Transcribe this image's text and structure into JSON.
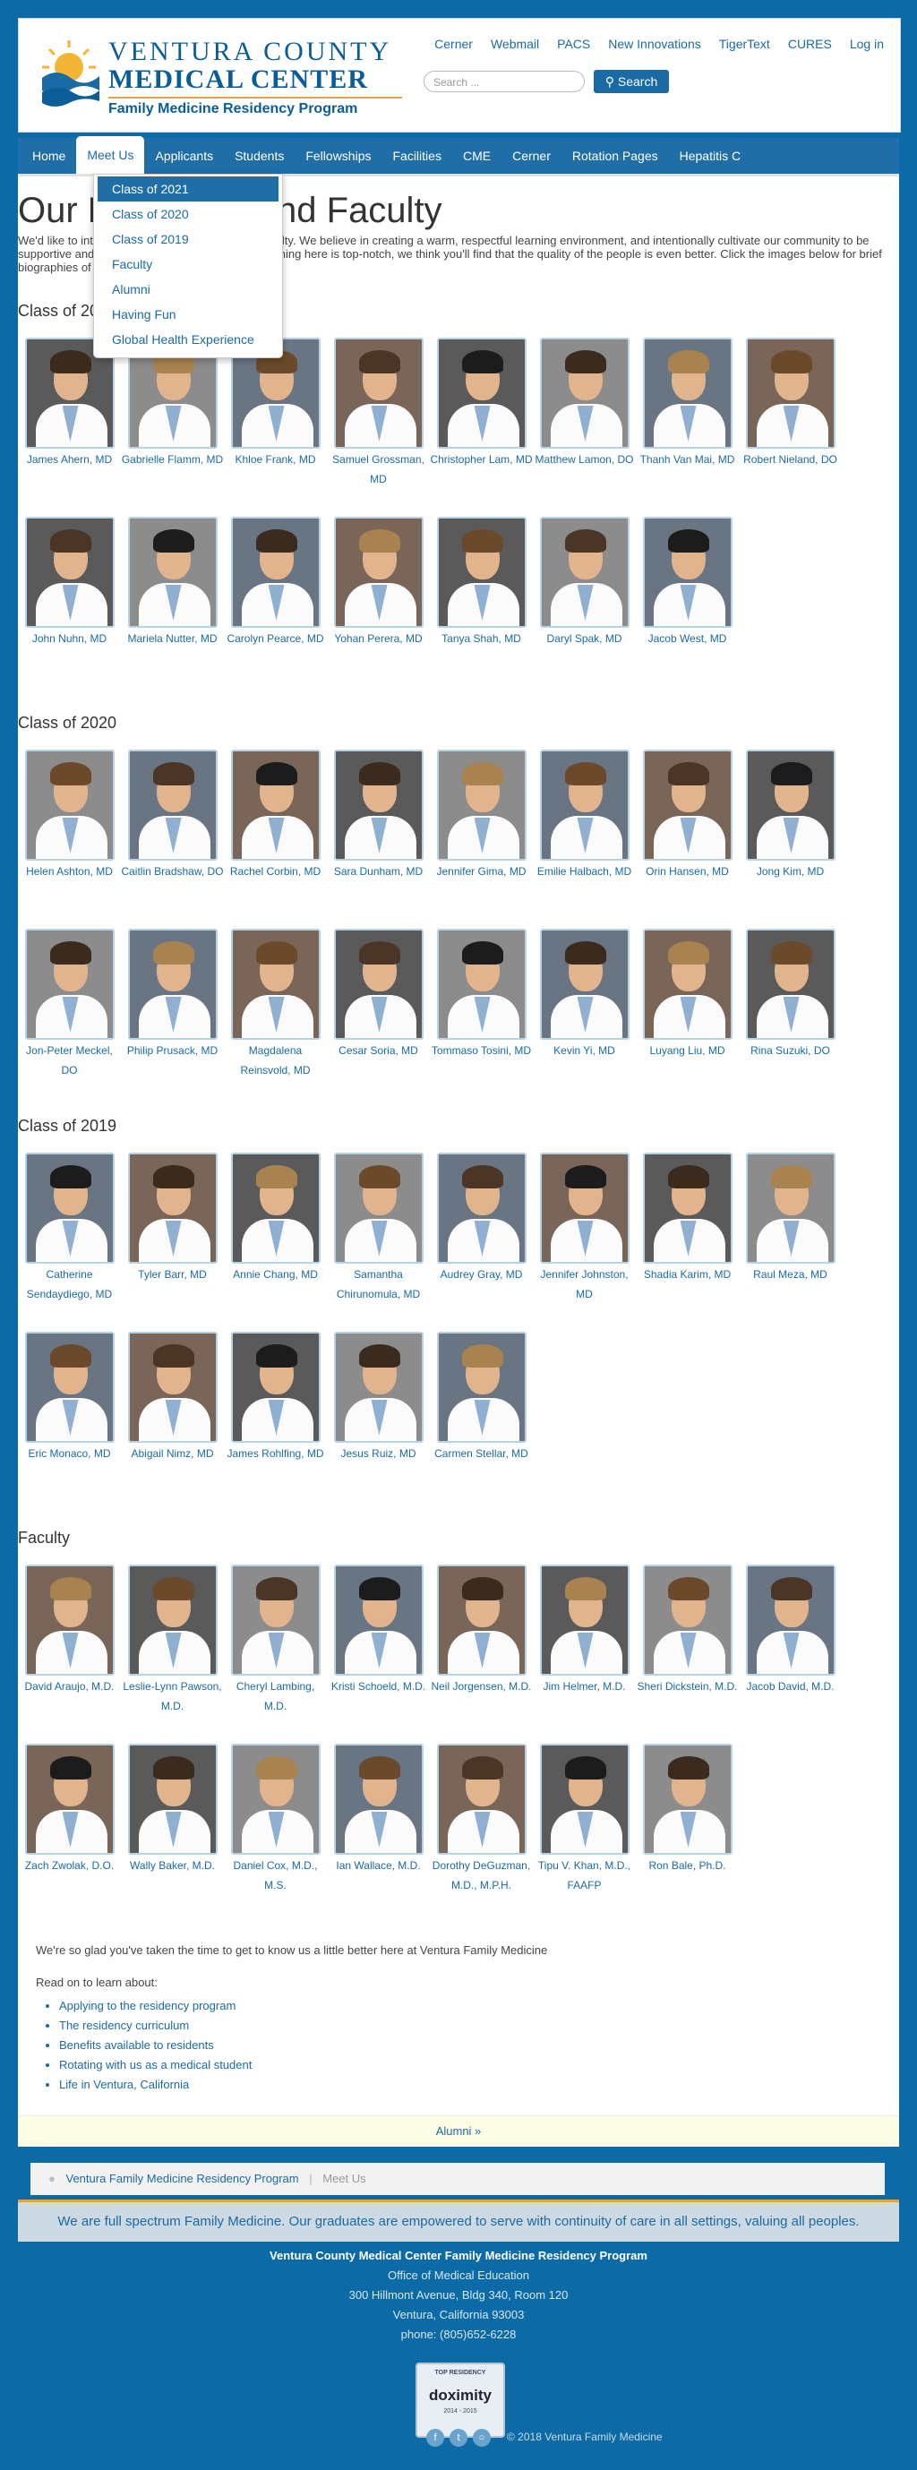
{
  "header": {
    "logo_line1": "VENTURA COUNTY",
    "logo_line2": "MEDICAL CENTER",
    "logo_line3": "Family Medicine Residency Program",
    "top_links": [
      "Cerner",
      "Webmail",
      "PACS",
      "New Innovations",
      "TigerText",
      "CURES",
      "Log in"
    ],
    "search_placeholder": "Search ...",
    "search_button": "Search"
  },
  "nav": {
    "items": [
      "Home",
      "Meet Us",
      "Applicants",
      "Students",
      "Fellowships",
      "Facilities",
      "CME",
      "Cerner",
      "Rotation Pages",
      "Hepatitis C"
    ],
    "active": "Meet Us"
  },
  "dropdown": {
    "items": [
      "Class of 2021",
      "Class of 2020",
      "Class of 2019",
      "Faculty",
      "Alumni",
      "Having Fun",
      "Global Health Experience"
    ],
    "selected": "Class of 2021"
  },
  "page": {
    "title": "Our Residents and Faculty",
    "intro": "We'd like to introduce you to our residents and faculty. We believe in creating a warm, respectful learning environment, and intentionally cultivate our community to be supportive and fun. Though we believe that the training here is top-notch, we think you'll find that the quality of the people is even better.  Click the images below for brief biographies of our residents and faculty."
  },
  "sections": [
    {
      "title": "Class of 2021",
      "people": [
        "James Ahern, MD",
        "Gabrielle Flamm, MD",
        "Khloe Frank, MD",
        "Samuel Grossman, MD",
        "Christopher Lam, MD",
        "Matthew Lamon, DO",
        "Thanh Van Mai, MD",
        "Robert Nieland, DO",
        "John Nuhn, MD",
        "Mariela Nutter, MD",
        "Carolyn Pearce, MD",
        "Yohan Perera, MD",
        "Tanya Shah, MD",
        "Daryl Spak, MD",
        "Jacob West, MD"
      ]
    },
    {
      "title": "Class of 2020",
      "people": [
        "Helen Ashton, MD",
        "Caitlin Bradshaw, DO",
        "Rachel Corbin, MD",
        "Sara Dunham, MD",
        "Jennifer Gima, MD",
        "Emilie Halbach, MD",
        "Orin Hansen, MD",
        "Jong Kim, MD",
        "Jon-Peter Meckel, DO",
        "Philip Prusack, MD",
        "Magdalena Reinsvold, MD",
        "Cesar Soria, MD",
        "Tommaso Tosini, MD",
        "Kevin Yi, MD",
        "Luyang Liu, MD",
        "Rina Suzuki, DO"
      ]
    },
    {
      "title": "Class of 2019",
      "people": [
        "Catherine Sendaydiego, MD",
        "Tyler Barr, MD",
        "Annie Chang, MD",
        "Samantha Chirunomula, MD",
        "Audrey Gray, MD",
        "Jennifer Johnston, MD",
        "Shadia Karim, MD",
        "Raul Meza, MD",
        "Eric Monaco, MD",
        "Abigail Nimz, MD",
        "James Rohlfing, MD",
        "Jesus Ruiz, MD",
        "Carmen Stellar, MD"
      ]
    },
    {
      "title": "Faculty",
      "people": [
        "David Araujo, M.D.",
        "Leslie-Lynn Pawson, M.D.",
        "Cheryl Lambing, M.D.",
        "Kristi Schoeld, M.D.",
        "Neil Jorgensen, M.D.",
        "Jim Helmer, M.D.",
        "Sheri Dickstein, M.D.",
        "Jacob David, M.D.",
        "Zach Zwolak, D.O.",
        "Wally Baker, M.D.",
        "Daniel Cox, M.D., M.S.",
        "Ian Wallace, M.D.",
        "Dorothy DeGuzman, M.D., M.P.H.",
        "Tipu V. Khan, M.D., FAAFP",
        "Ron Bale, Ph.D."
      ]
    }
  ],
  "outro": {
    "text1": "We're so glad you've taken the time to get to know us a little better here at Ventura Family Medicine",
    "text2": "Read on to learn about:",
    "links": [
      "Applying to the residency program",
      "The residency curriculum",
      "Benefits available to residents",
      "Rotating with us as a medical student",
      "Life in Ventura, California"
    ]
  },
  "alumni_link": "Alumni »",
  "breadcrumb": {
    "home": "Ventura Family Medicine Residency Program",
    "sep": "|",
    "current": "Meet Us"
  },
  "tagline": "We are full spectrum Family Medicine. Our graduates are empowered to serve with continuity of care in all settings, valuing all peoples.",
  "footer": {
    "title": "Ventura County Medical Center Family Medicine Residency Program",
    "line1": "Office of Medical Education",
    "line2": "300 Hillmont Avenue, Bldg 340, Room 120",
    "line3": "Ventura, California 93003",
    "line4": "phone: (805)652-6228",
    "badge_top": "TOP RESIDENCY",
    "badge_name": "doximity",
    "badge_year": "2014 - 2015",
    "copyright": "© 2018 Ventura Family Medicine"
  },
  "colors": {
    "brand": "#0c6ba6",
    "link": "#1a6aa5",
    "accent": "#e5a43a"
  }
}
